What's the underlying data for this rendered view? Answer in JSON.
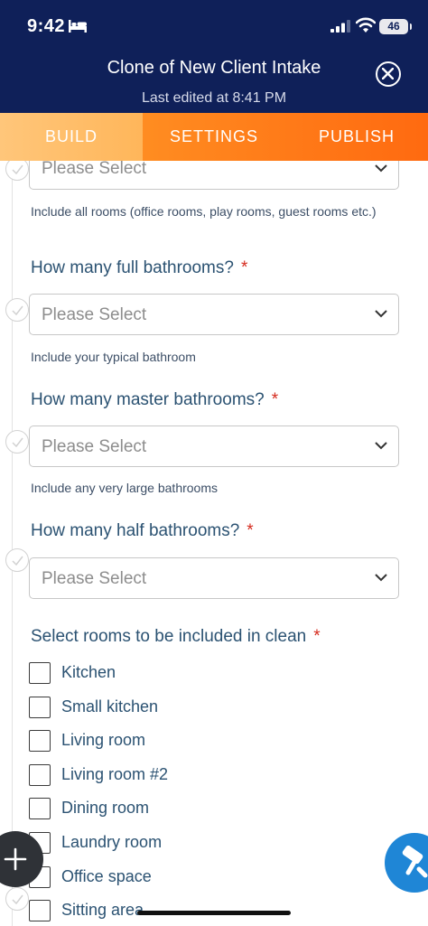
{
  "status": {
    "time": "9:42",
    "battery": "46"
  },
  "header": {
    "title": "Clone of New Client Intake",
    "subtitle": "Last edited at 8:41 PM"
  },
  "tabs": [
    {
      "label": "BUILD",
      "active": true
    },
    {
      "label": "SETTINGS",
      "active": false
    },
    {
      "label": "PUBLISH",
      "active": false
    }
  ],
  "form": {
    "placeholder": "Please Select",
    "top_help": "Include all rooms (office rooms, play rooms, guest rooms etc.)",
    "questions": [
      {
        "label": "How many full bathrooms?",
        "required": "*",
        "help": "Include your typical bathroom"
      },
      {
        "label": "How many master bathrooms?",
        "required": "*",
        "help": "Include any very large bathrooms"
      },
      {
        "label": "How many half bathrooms?",
        "required": "*",
        "help": ""
      }
    ],
    "rooms": {
      "label": "Select rooms to be included in clean",
      "required": "*",
      "options": [
        "Kitchen",
        "Small kitchen",
        "Living room",
        "Living room #2",
        "Dining room",
        "Laundry room",
        "Office space",
        "Sitting area"
      ]
    }
  },
  "colors": {
    "header_bg": "#0f2059",
    "tab_orange": "#ff7e1a",
    "label_blue": "#2b5272",
    "required_red": "#d52b1e",
    "fab_blue": "#1f86d6"
  }
}
